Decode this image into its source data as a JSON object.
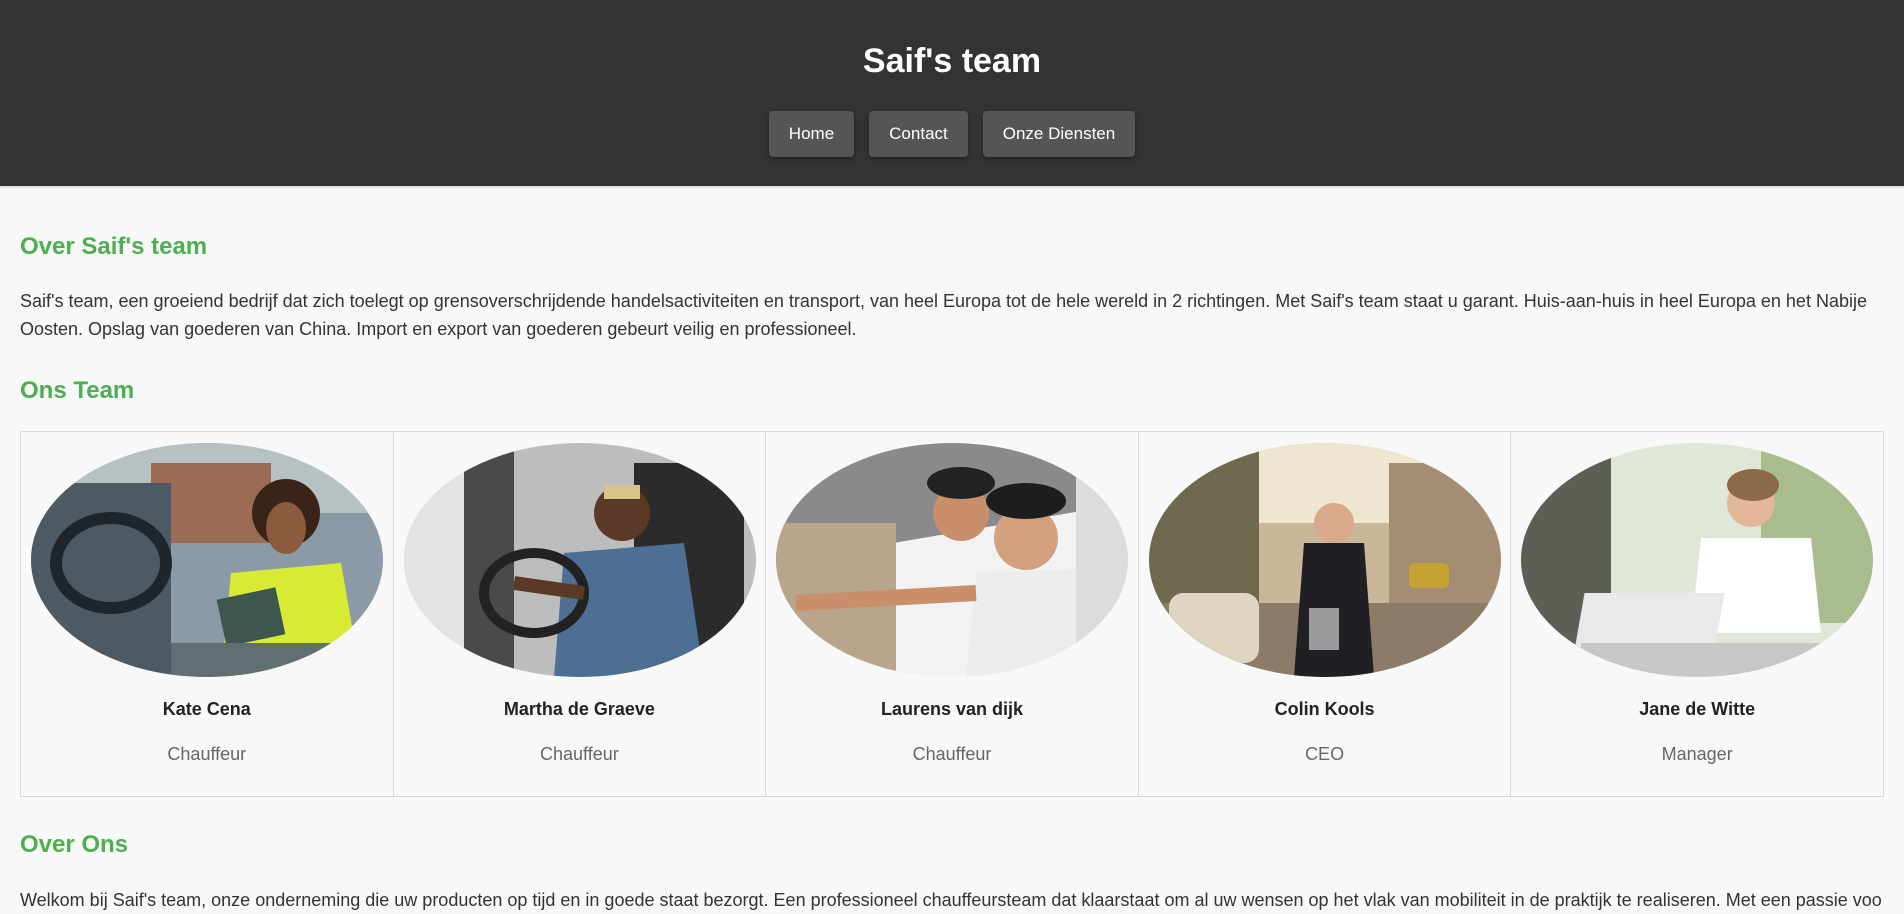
{
  "header": {
    "title": "Saif's team",
    "nav": [
      {
        "label": "Home"
      },
      {
        "label": "Contact"
      },
      {
        "label": "Onze Diensten"
      }
    ]
  },
  "about": {
    "heading": "Over Saif's team",
    "text": "Saif's team, een groeiend bedrijf dat zich toelegt op grensoverschrijdende handelsactiviteiten en transport, van heel Europa tot de hele wereld in 2 richtingen. Met Saif's team staat u garant. Huis-aan-huis in heel Europa en het Nabije Oosten. Opslag van goederen van China. Import en export van goederen gebeurt veilig en professioneel."
  },
  "team": {
    "heading": "Ons Team",
    "members": [
      {
        "name": "Kate Cena",
        "role": "Chauffeur",
        "photo": "woman-in-van-with-tablet-photo"
      },
      {
        "name": "Martha de Graeve",
        "role": "Chauffeur",
        "photo": "man-driving-truck-photo"
      },
      {
        "name": "Laurens van dijk",
        "role": "Chauffeur",
        "photo": "two-men-in-van-photo"
      },
      {
        "name": "Colin Kools",
        "role": "CEO",
        "photo": "man-in-suit-on-street-photo"
      },
      {
        "name": "Jane de Witte",
        "role": "Manager",
        "photo": "woman-at-laptop-photo"
      }
    ]
  },
  "over_ons": {
    "heading": "Over Ons",
    "text": "Welkom bij Saif's team, onze onderneming die uw producten op tijd en in goede staat bezorgt. Een professioneel chauffeursteam dat klaarstaat om al uw wensen op het vlak van mobiliteit in de praktijk te realiseren. Met een passie voor de"
  },
  "colors": {
    "header_bg": "#333333",
    "nav_button_bg": "#555555",
    "heading_green": "#4caf50",
    "page_bg": "#f8f8f8"
  }
}
